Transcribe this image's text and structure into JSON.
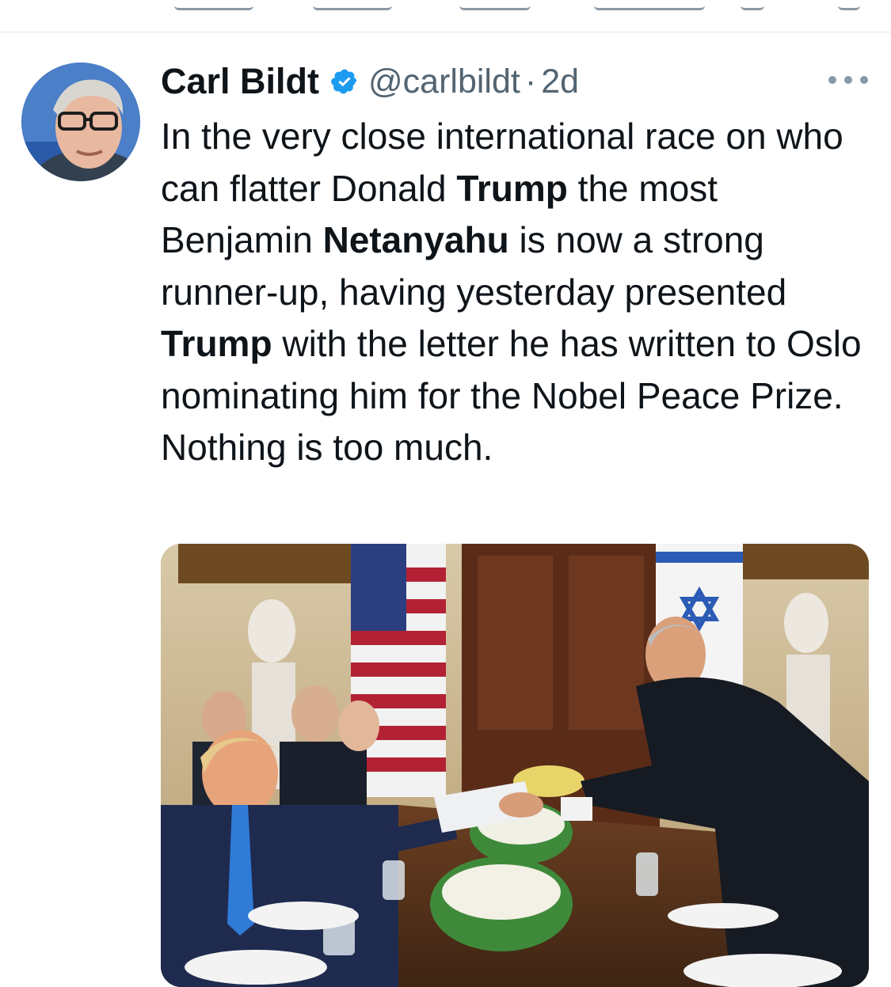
{
  "tweet": {
    "author_name": "Carl Bildt",
    "handle": "@carlbildt",
    "separator": "·",
    "time": "2d",
    "text_parts": [
      {
        "text": "In the very close international race on who can flatter Donald ",
        "bold": false
      },
      {
        "text": "Trump",
        "bold": true
      },
      {
        "text": " the most Benjamin ",
        "bold": false
      },
      {
        "text": "Netanyahu",
        "bold": true
      },
      {
        "text": " is now a strong runner-up, having yesterday presented ",
        "bold": false
      },
      {
        "text": "Trump",
        "bold": true
      },
      {
        "text": " with the letter he has written to Oslo nominating him for the Nobel Peace Prize. Nothing is too much.",
        "bold": false
      }
    ]
  },
  "colors": {
    "text_primary": "#0f1419",
    "text_secondary": "#536471",
    "verified_blue": "#1d9bf0",
    "divider": "#e1e6ea"
  },
  "icons": {
    "verified": "verified-badge-icon",
    "more": "more-options-icon"
  }
}
